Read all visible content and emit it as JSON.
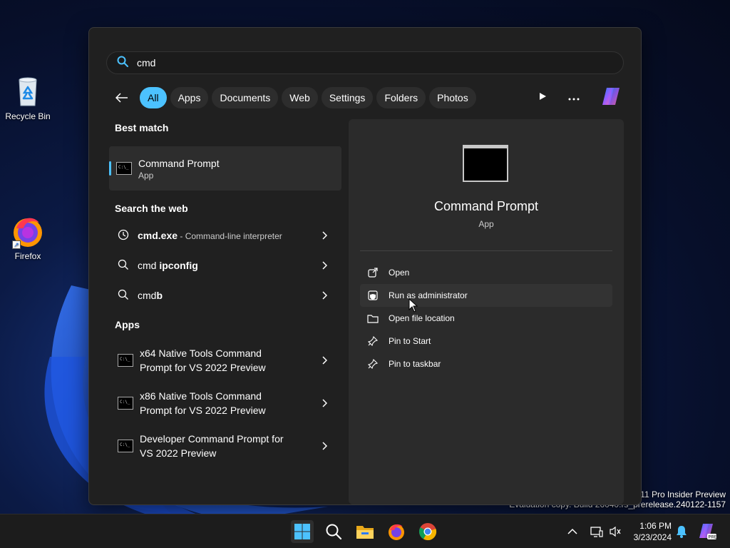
{
  "desktop": {
    "icons": [
      {
        "label": "Recycle Bin"
      },
      {
        "label": "Firefox"
      }
    ],
    "watermark": {
      "line1": "s 11 Pro Insider Preview",
      "line2": "Evaluation copy. Build 26040.rs_prerelease.240122-1157"
    }
  },
  "search": {
    "value": "cmd",
    "placeholder": "Search"
  },
  "filters": [
    "All",
    "Apps",
    "Documents",
    "Web",
    "Settings",
    "Folders",
    "Photos"
  ],
  "active_filter": "All",
  "best_match": {
    "section": "Best match",
    "title": "Command Prompt",
    "subtitle": "App"
  },
  "web": {
    "section": "Search the web",
    "items": [
      {
        "bold": "cmd.exe",
        "desc": " - Command-line interpreter",
        "plain_prefix": ""
      },
      {
        "plain_prefix": "cmd ",
        "bold": "ipconfig",
        "desc": ""
      },
      {
        "plain_prefix": "cmd",
        "bold": "b",
        "desc": ""
      }
    ]
  },
  "apps": {
    "section": "Apps",
    "items": [
      {
        "line1": "x64 Native Tools Command",
        "line2": "Prompt for VS 2022 Preview"
      },
      {
        "line1": "x86 Native Tools Command",
        "line2": "Prompt for VS 2022 Preview"
      },
      {
        "line1": "Developer Command Prompt for",
        "line2": "VS 2022 Preview"
      }
    ]
  },
  "preview": {
    "title": "Command Prompt",
    "subtitle": "App",
    "actions": [
      {
        "label": "Open",
        "icon": "open-external-icon"
      },
      {
        "label": "Run as administrator",
        "icon": "shield-admin-icon"
      },
      {
        "label": "Open file location",
        "icon": "folder-icon"
      },
      {
        "label": "Pin to Start",
        "icon": "pin-icon"
      },
      {
        "label": "Pin to taskbar",
        "icon": "pin-icon"
      }
    ]
  },
  "clock": {
    "time": "1:06 PM",
    "date": "3/23/2024"
  },
  "colors": {
    "accent": "#4cc2ff",
    "panel": "#202020",
    "preview_bg": "#2b2b2b"
  }
}
